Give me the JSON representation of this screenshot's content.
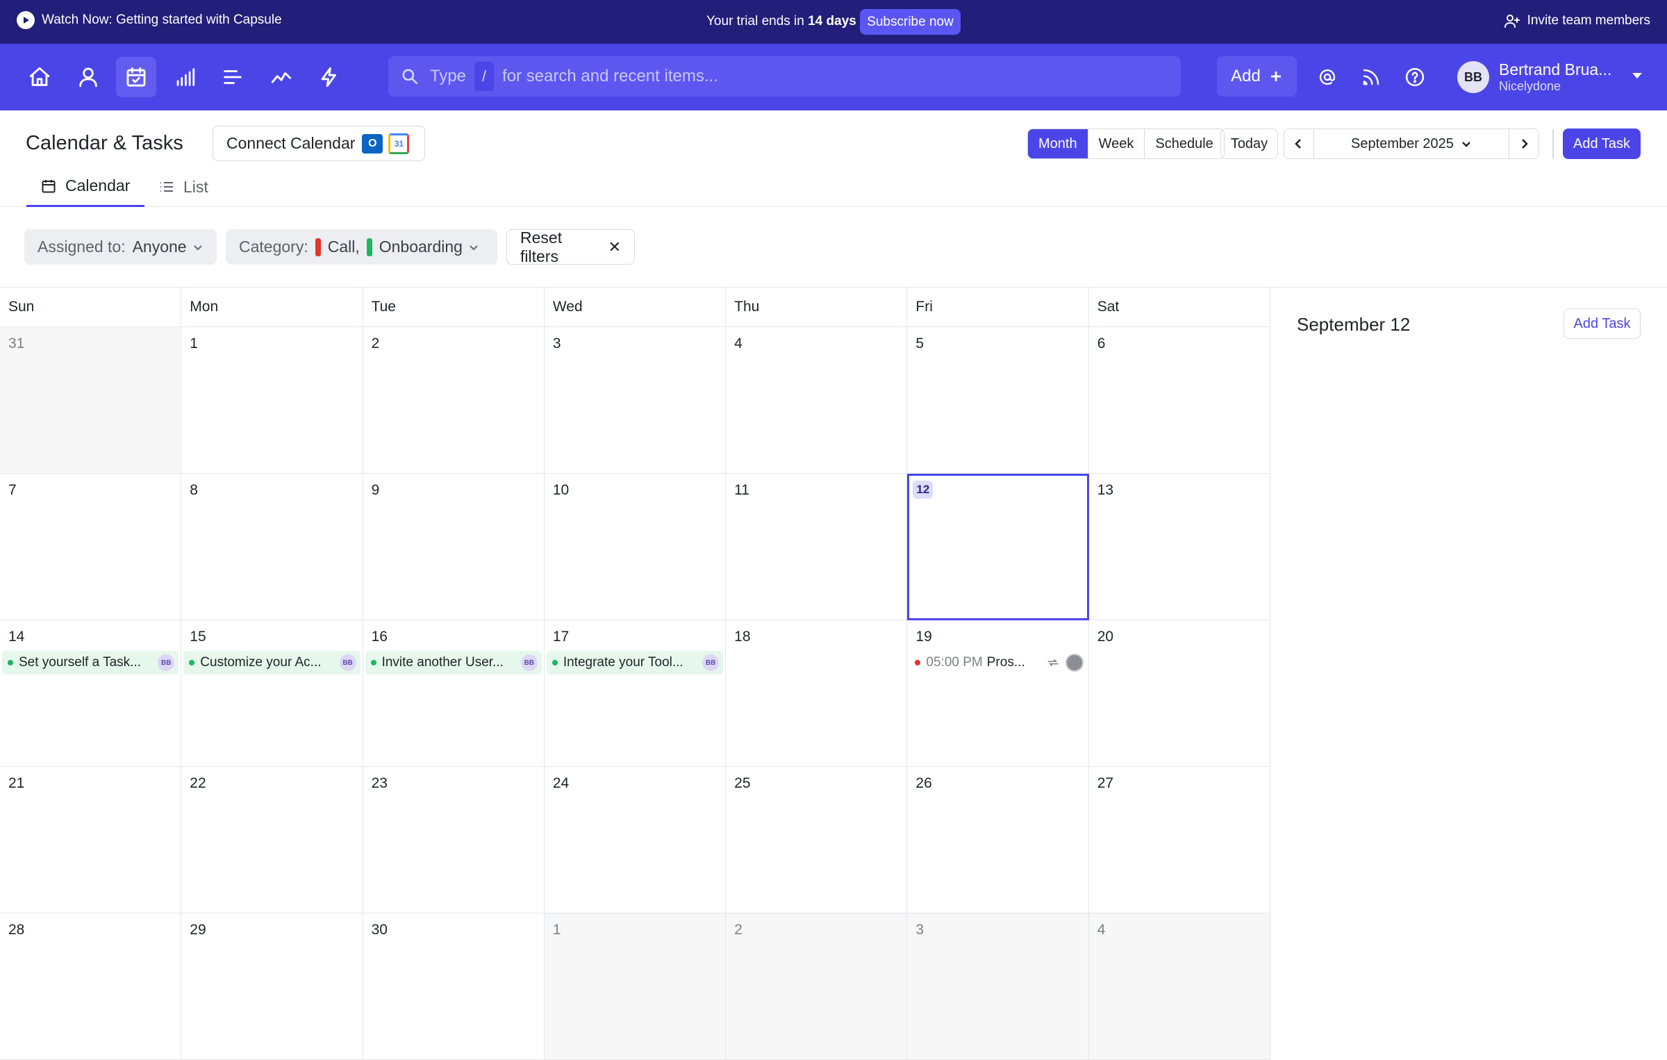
{
  "banner": {
    "watch_label": "Watch Now: Getting started with Capsule",
    "trial_prefix": "Your trial ends in ",
    "trial_days": "14 days",
    "subscribe_label": "Subscribe now",
    "invite_label": "Invite team members"
  },
  "nav": {
    "icons": [
      "home-icon",
      "person-icon",
      "calendar-check-icon",
      "bar-chart-icon",
      "lines-icon",
      "trend-icon",
      "bolt-icon"
    ],
    "search_prefix": "Type",
    "search_slash": "/",
    "search_suffix": "for search and recent items...",
    "add_label": "Add",
    "user_initials": "BB",
    "user_name": "Bertrand Brua...",
    "user_org": "Nicelydone",
    "accent": "#4b45e8",
    "banner_bg": "#211f79"
  },
  "header": {
    "title": "Calendar & Tasks",
    "connect_label": "Connect Calendar",
    "views": [
      "Month",
      "Week",
      "Schedule"
    ],
    "active_view": "Month",
    "today_label": "Today",
    "month_label": "September 2025",
    "add_task_label": "Add Task"
  },
  "tabs": [
    {
      "label": "Calendar",
      "active": true
    },
    {
      "label": "List",
      "active": false
    }
  ],
  "filters": {
    "assigned_label": "Assigned to:",
    "assigned_value": "Anyone",
    "category_label": "Category:",
    "category_values": [
      {
        "name": "Call,",
        "color": "#e5342c"
      },
      {
        "name": "Onboarding",
        "color": "#1db560"
      }
    ],
    "reset_label": "Reset filters"
  },
  "calendar": {
    "weekdays": [
      "Sun",
      "Mon",
      "Tue",
      "Wed",
      "Thu",
      "Fri",
      "Sat"
    ],
    "weeks": [
      [
        {
          "d": "31",
          "m": true
        },
        {
          "d": "1"
        },
        {
          "d": "2"
        },
        {
          "d": "3"
        },
        {
          "d": "4"
        },
        {
          "d": "5"
        },
        {
          "d": "6"
        }
      ],
      [
        {
          "d": "7"
        },
        {
          "d": "8"
        },
        {
          "d": "9"
        },
        {
          "d": "10"
        },
        {
          "d": "11"
        },
        {
          "d": "12",
          "sel": true
        },
        {
          "d": "13"
        }
      ],
      [
        {
          "d": "14",
          "ev": {
            "title": "Set yourself a Task...",
            "badge": "BB"
          }
        },
        {
          "d": "15",
          "ev": {
            "title": "Customize your Ac...",
            "badge": "BB"
          }
        },
        {
          "d": "16",
          "ev": {
            "title": "Invite another User...",
            "badge": "BB"
          }
        },
        {
          "d": "17",
          "ev": {
            "title": "Integrate your Tool...",
            "badge": "BB"
          }
        },
        {
          "d": "18"
        },
        {
          "d": "19",
          "call": {
            "time": "05:00 PM",
            "title": "Pros..."
          }
        },
        {
          "d": "20"
        }
      ],
      [
        {
          "d": "21"
        },
        {
          "d": "22"
        },
        {
          "d": "23"
        },
        {
          "d": "24"
        },
        {
          "d": "25"
        },
        {
          "d": "26"
        },
        {
          "d": "27"
        }
      ],
      [
        {
          "d": "28"
        },
        {
          "d": "29"
        },
        {
          "d": "30"
        },
        {
          "d": "1",
          "m": true
        },
        {
          "d": "2",
          "m": true
        },
        {
          "d": "3",
          "m": true
        },
        {
          "d": "4",
          "m": true
        }
      ]
    ]
  },
  "side_panel": {
    "title": "September 12",
    "add_task_label": "Add Task"
  }
}
